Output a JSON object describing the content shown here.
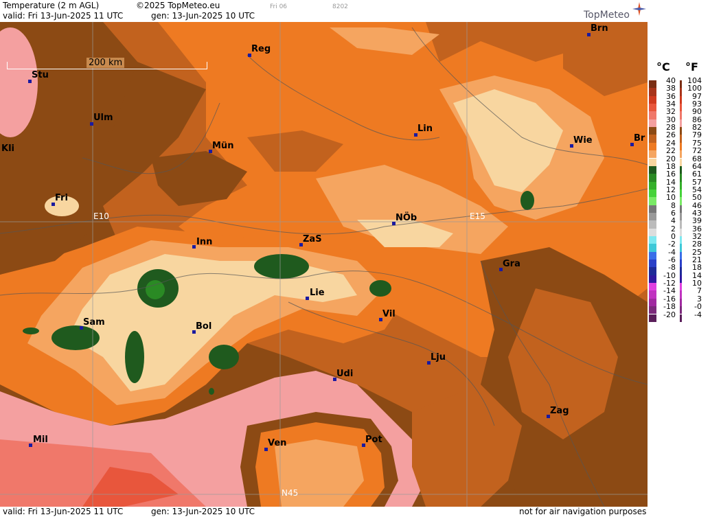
{
  "header": {
    "title": "Temperature (2 m AGL)",
    "copyright": "©2025 TopMeteo.eu",
    "small_code1": "Fri 06",
    "small_code2": "8202",
    "valid": "valid:  Fri  13-Jun-2025  11 UTC",
    "gen": "gen: 13-Jun-2025 10 UTC",
    "brand": "TopMeteo"
  },
  "footer": {
    "valid": "valid:  Fri  13-Jun-2025  11 UTC",
    "gen": "gen: 13-Jun-2025 10 UTC",
    "disclaimer": "not for air navigation purposes"
  },
  "map": {
    "scale_label": "200 km",
    "grid_labels": [
      "E10",
      "E15",
      "N45"
    ],
    "cities": [
      "Brn",
      "Reg",
      "Stu",
      "Ulm",
      "Lin",
      "Kli",
      "Mün",
      "Wie",
      "Br",
      "Fri",
      "NÖb",
      "E10",
      "Inn",
      "ZaS",
      "Gra",
      "Lie",
      "Vil",
      "Sam",
      "Bol",
      "Lju",
      "Udi",
      "Zag",
      "Mil",
      "Ven",
      "Pot"
    ]
  },
  "legend": {
    "unit_c": "°C",
    "unit_f": "°F",
    "rows": [
      {
        "c": "40",
        "f": "104",
        "color": "#7a2e14"
      },
      {
        "c": "38",
        "f": "100",
        "color": "#a8341a"
      },
      {
        "c": "36",
        "f": "97",
        "color": "#d03a1e"
      },
      {
        "c": "34",
        "f": "93",
        "color": "#e8563c"
      },
      {
        "c": "32",
        "f": "90",
        "color": "#f0786a"
      },
      {
        "c": "30",
        "f": "86",
        "color": "#f4a0a0"
      },
      {
        "c": "28",
        "f": "82",
        "color": "#8c4a14"
      },
      {
        "c": "26",
        "f": "79",
        "color": "#c2621e"
      },
      {
        "c": "24",
        "f": "75",
        "color": "#ee7a22"
      },
      {
        "c": "22",
        "f": "72",
        "color": "#f5a560"
      },
      {
        "c": "20",
        "f": "68",
        "color": "#f8d6a0"
      },
      {
        "c": "18",
        "f": "64",
        "color": "#1f5a1e"
      },
      {
        "c": "16",
        "f": "61",
        "color": "#2a8a24"
      },
      {
        "c": "14",
        "f": "57",
        "color": "#34b02a"
      },
      {
        "c": "12",
        "f": "54",
        "color": "#46d23a"
      },
      {
        "c": "10",
        "f": "50",
        "color": "#7aea66"
      },
      {
        "c": "8",
        "f": "46",
        "color": "#777777"
      },
      {
        "c": "6",
        "f": "43",
        "color": "#999999"
      },
      {
        "c": "4",
        "f": "39",
        "color": "#bbbbbb"
      },
      {
        "c": "2",
        "f": "36",
        "color": "#dddddd"
      },
      {
        "c": "0",
        "f": "32",
        "color": "#7ee8f0"
      },
      {
        "c": "-2",
        "f": "28",
        "color": "#3ec8d8"
      },
      {
        "c": "-4",
        "f": "25",
        "color": "#3a6ee8"
      },
      {
        "c": "-6",
        "f": "21",
        "color": "#2a40c8"
      },
      {
        "c": "-8",
        "f": "18",
        "color": "#1e2a98"
      },
      {
        "c": "-10",
        "f": "14",
        "color": "#3018a0"
      },
      {
        "c": "-12",
        "f": "10",
        "color": "#e040e0"
      },
      {
        "c": "-14",
        "f": "7",
        "color": "#c034c0"
      },
      {
        "c": "-16",
        "f": "3",
        "color": "#a02aa0"
      },
      {
        "c": "-18",
        "f": "-0",
        "color": "#7c2a7c"
      },
      {
        "c": "-20",
        "f": "-4",
        "color": "#5a1e5a"
      }
    ]
  },
  "colors": {
    "brown": "#8c4a14",
    "dark_orange": "#c2621e",
    "orange": "#ee7a22",
    "light_orange": "#f5a560",
    "beige": "#f8d6a0",
    "dark_green": "#1f5a1e",
    "pink": "#f4a0a0",
    "salmon": "#f0786a"
  }
}
